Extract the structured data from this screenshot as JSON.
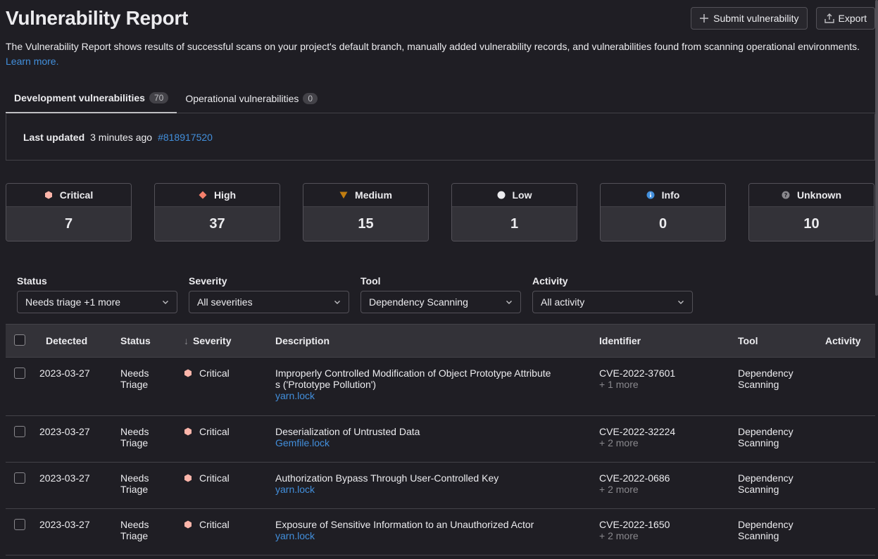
{
  "header": {
    "title": "Vulnerability Report",
    "submit_label": "Submit vulnerability",
    "export_label": "Export"
  },
  "intro": {
    "text": "The Vulnerability Report shows results of successful scans on your project's default branch, manually added vulnerability records, and vulnerabilities found from scanning operational environments. ",
    "link": "Learn more."
  },
  "tabs": [
    {
      "label": "Development vulnerabilities",
      "count": "70"
    },
    {
      "label": "Operational vulnerabilities",
      "count": "0"
    }
  ],
  "last_updated": {
    "label": "Last updated",
    "time": "3 minutes ago",
    "pipeline": "#818917520"
  },
  "severity_cards": [
    {
      "label": "Critical",
      "value": "7",
      "color": "#f57f6c"
    },
    {
      "label": "High",
      "value": "37",
      "color": "#f57f6c"
    },
    {
      "label": "Medium",
      "value": "15",
      "color": "#c17d10"
    },
    {
      "label": "Low",
      "value": "1",
      "color": "#ececef"
    },
    {
      "label": "Info",
      "value": "0",
      "color": "#428fdc"
    },
    {
      "label": "Unknown",
      "value": "10",
      "color": "#89888d"
    }
  ],
  "filters": [
    {
      "label": "Status",
      "value": "Needs triage +1 more"
    },
    {
      "label": "Severity",
      "value": "All severities"
    },
    {
      "label": "Tool",
      "value": "Dependency Scanning"
    },
    {
      "label": "Activity",
      "value": "All activity"
    }
  ],
  "table": {
    "columns": [
      "Detected",
      "Status",
      "Severity",
      "Description",
      "Identifier",
      "Tool",
      "Activity"
    ],
    "rows": [
      {
        "detected": "2023-03-27",
        "status1": "Needs",
        "status2": "Triage",
        "severity": "Critical",
        "desc1": "Improperly Controlled Modification of Object Prototype Attribute",
        "desc2": "s ('Prototype Pollution')",
        "file": "yarn.lock",
        "ident": "CVE-2022-37601",
        "more": "+ 1 more",
        "tool1": "Dependency",
        "tool2": "Scanning"
      },
      {
        "detected": "2023-03-27",
        "status1": "Needs",
        "status2": "Triage",
        "severity": "Critical",
        "desc1": "Deserialization of Untrusted Data",
        "desc2": "",
        "file": "Gemfile.lock",
        "ident": "CVE-2022-32224",
        "more": "+ 2 more",
        "tool1": "Dependency",
        "tool2": "Scanning"
      },
      {
        "detected": "2023-03-27",
        "status1": "Needs",
        "status2": "Triage",
        "severity": "Critical",
        "desc1": "Authorization Bypass Through User-Controlled Key",
        "desc2": "",
        "file": "yarn.lock",
        "ident": "CVE-2022-0686",
        "more": "+ 2 more",
        "tool1": "Dependency",
        "tool2": "Scanning"
      },
      {
        "detected": "2023-03-27",
        "status1": "Needs",
        "status2": "Triage",
        "severity": "Critical",
        "desc1": "Exposure of Sensitive Information to an Unauthorized Actor",
        "desc2": "",
        "file": "yarn.lock",
        "ident": "CVE-2022-1650",
        "more": "+ 2 more",
        "tool1": "Dependency",
        "tool2": "Scanning"
      }
    ]
  }
}
